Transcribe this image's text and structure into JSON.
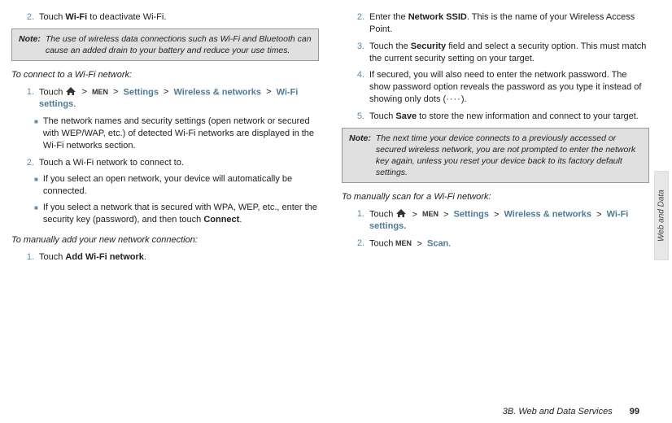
{
  "col1": {
    "step2_num": "2.",
    "step2_a": "Touch ",
    "step2_wifi": "Wi-Fi",
    "step2_b": " to deactivate Wi-Fi.",
    "note1_label": "Note:",
    "note1_body": "The use of wireless data connections such as Wi-Fi and Bluetooth can cause an added drain to your battery and reduce your use times.",
    "heading_connect": "To connect to a Wi-Fi network:",
    "c_step1_num": "1.",
    "c_step1_a": "Touch ",
    "c_step1_settings": "Settings",
    "c_step1_wn": "Wireless & networks",
    "c_step1_ws": "Wi-Fi settings",
    "c_sub1": "The network names and security settings (open network or secured with WEP/WAP, etc.) of detected Wi-Fi networks are displayed in the Wi-Fi networks section.",
    "c_step2_num": "2.",
    "c_step2_body": "Touch a Wi-Fi network to connect to.",
    "c_sub2": "If you select an open network, your device will automatically be connected.",
    "c_sub3_a": "If you select a network that is secured with WPA, WEP, etc., enter the security key (password), and then touch ",
    "c_sub3_connect": "Connect",
    "heading_manualadd": "To manually add your new network connection:",
    "m_step1_num": "1.",
    "m_step1_a": "Touch ",
    "m_step1_add": "Add Wi-Fi network"
  },
  "col2": {
    "r_step2_num": "2.",
    "r_step2_a": "Enter the ",
    "r_step2_ssid": "Network SSID",
    "r_step2_b": ". This is the name of your Wireless Access Point.",
    "r_step3_num": "3.",
    "r_step3_a": "Touch the ",
    "r_step3_sec": "Security",
    "r_step3_b": " field and select a security option. This must match the current security setting on your target.",
    "r_step4_num": "4.",
    "r_step4_a": "If secured, you will also need to enter the network password. The show password option reveals the password as you type it instead of showing only dots (",
    "r_step4_dots": "····",
    "r_step4_b": ").",
    "r_step5_num": "5.",
    "r_step5_a": "Touch ",
    "r_step5_save": "Save",
    "r_step5_b": " to store the new information and connect to your target.",
    "note2_label": "Note:",
    "note2_body": "The next time your device connects to a previously accessed or secured wireless network, you are not prompted to enter the network key again, unless you reset your device back to its factory default settings.",
    "heading_scan": "To manually scan for a Wi-Fi network:",
    "s_step1_num": "1.",
    "s_step1_a": "Touch ",
    "s_step1_settings": "Settings",
    "s_step1_wn": "Wireless & networks",
    "s_step1_ws": "Wi-Fi settings.",
    "s_step2_num": "2.",
    "s_step2_a": "Touch ",
    "s_step2_scan": "Scan"
  },
  "footer": {
    "title": "3B. Web and Data Services",
    "page": "99"
  },
  "sidetab": "Web and Data",
  "glyphs": {
    "gt": ">",
    "dot": ".",
    "sq": "■"
  }
}
